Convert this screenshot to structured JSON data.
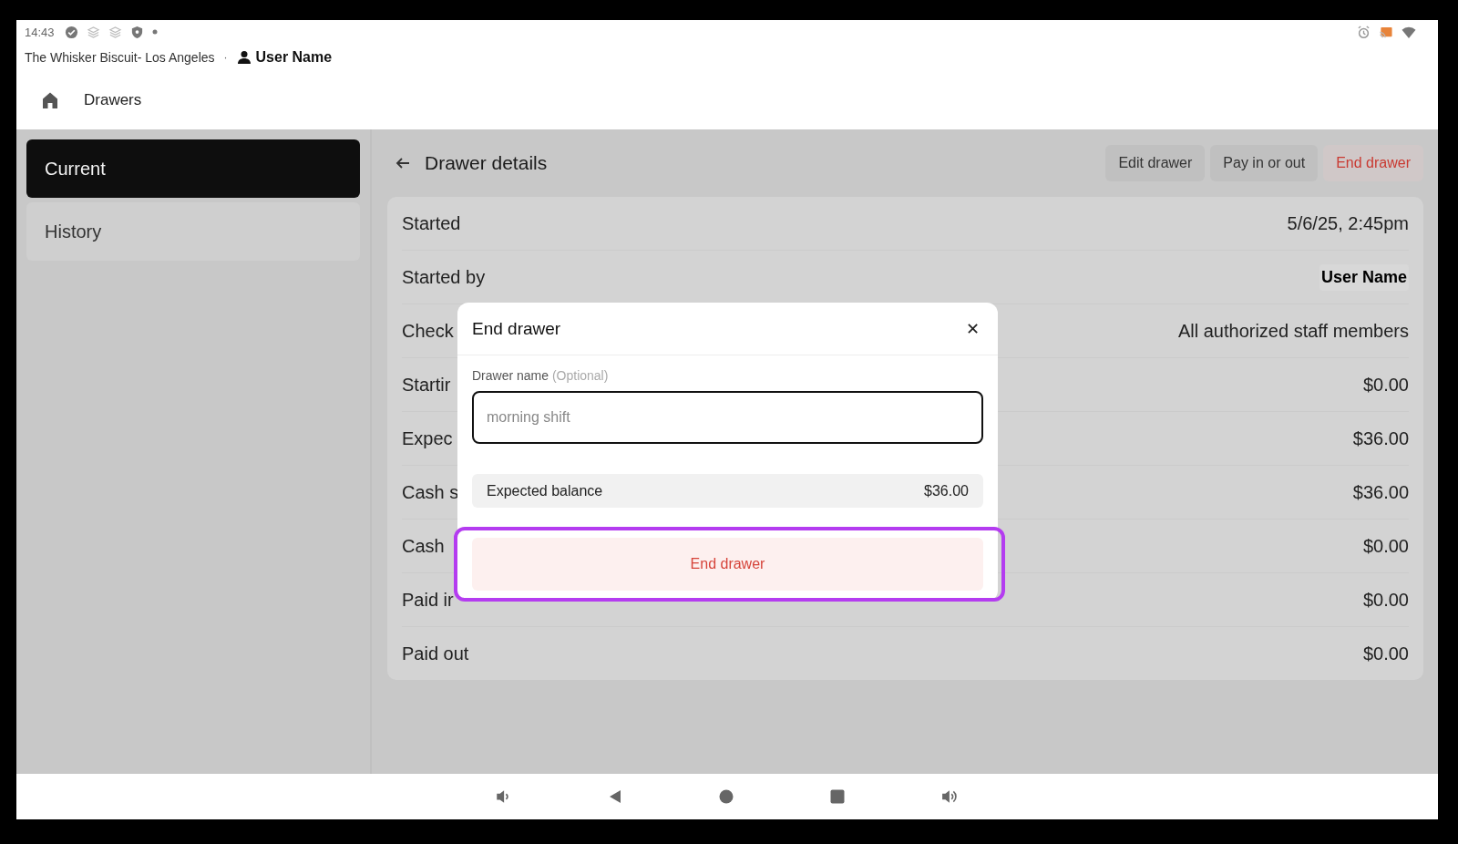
{
  "status_bar": {
    "time": "14:43"
  },
  "header": {
    "location": "The Whisker Biscuit- Los Angeles",
    "separator": "·",
    "user": "User Name"
  },
  "nav": {
    "title": "Drawers"
  },
  "sidebar": {
    "items": [
      {
        "label": "Current",
        "selected": true
      },
      {
        "label": "History",
        "selected": false
      }
    ]
  },
  "page": {
    "title": "Drawer details",
    "actions": [
      {
        "label": "Edit drawer",
        "kind": "plain"
      },
      {
        "label": "Pay in or out",
        "kind": "plain"
      },
      {
        "label": "End drawer",
        "kind": "danger"
      }
    ]
  },
  "details": [
    {
      "label": "Started",
      "value": "5/6/25, 2:45pm",
      "kind": "text"
    },
    {
      "label": "Started by",
      "value": "User Name",
      "kind": "user"
    },
    {
      "label": "Check",
      "value": "All authorized staff members",
      "kind": "text"
    },
    {
      "label": "Startir",
      "value": "$0.00",
      "kind": "text"
    },
    {
      "label": "Expec",
      "value": "$36.00",
      "kind": "text"
    },
    {
      "label": "Cash s",
      "value": "$36.00",
      "kind": "text"
    },
    {
      "label": "Cash",
      "value": "$0.00",
      "kind": "text"
    },
    {
      "label": "Paid ir",
      "value": "$0.00",
      "kind": "text"
    },
    {
      "label": "Paid out",
      "value": "$0.00",
      "kind": "text"
    }
  ],
  "modal": {
    "title": "End drawer",
    "close": "✕",
    "field_label": "Drawer name",
    "field_hint": "(Optional)",
    "placeholder": "morning shift",
    "balance_label": "Expected balance",
    "balance_value": "$36.00",
    "end_button": {
      "label": "End drawer",
      "highlighted": true
    }
  }
}
